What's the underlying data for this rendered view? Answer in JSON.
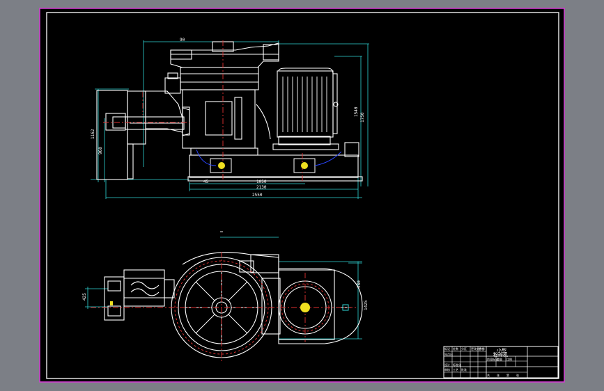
{
  "drawing": {
    "top_view_dims": {
      "top_width": "90",
      "overall_height": "1750",
      "inner_height": "1540",
      "left_height": "1162",
      "left_lower": "960",
      "base_left": "45",
      "base_mid": "1050",
      "base_total": "2130",
      "overall_length": "2550"
    },
    "plan_view_dims": {
      "right_upper": "380",
      "right_total": "1425",
      "left_offset": "425"
    }
  },
  "title_block": {
    "title_line_1": "小型",
    "title_line_2": "粉碎机",
    "cells": [
      "标记",
      "处数",
      "分区",
      "更改文件号",
      "签名",
      "年月日",
      "阶段标记",
      "重量",
      "比例",
      "设计",
      "标准化",
      "审核",
      "工艺",
      "批准",
      "共",
      "张",
      "第",
      "张"
    ]
  },
  "colors": {
    "frame": "#d63bd6",
    "outline": "#ffffff",
    "dimension": "#2fd6d6",
    "centerline": "#e03030",
    "hidden": "#2a46ff",
    "hatch": "#f0e020"
  }
}
